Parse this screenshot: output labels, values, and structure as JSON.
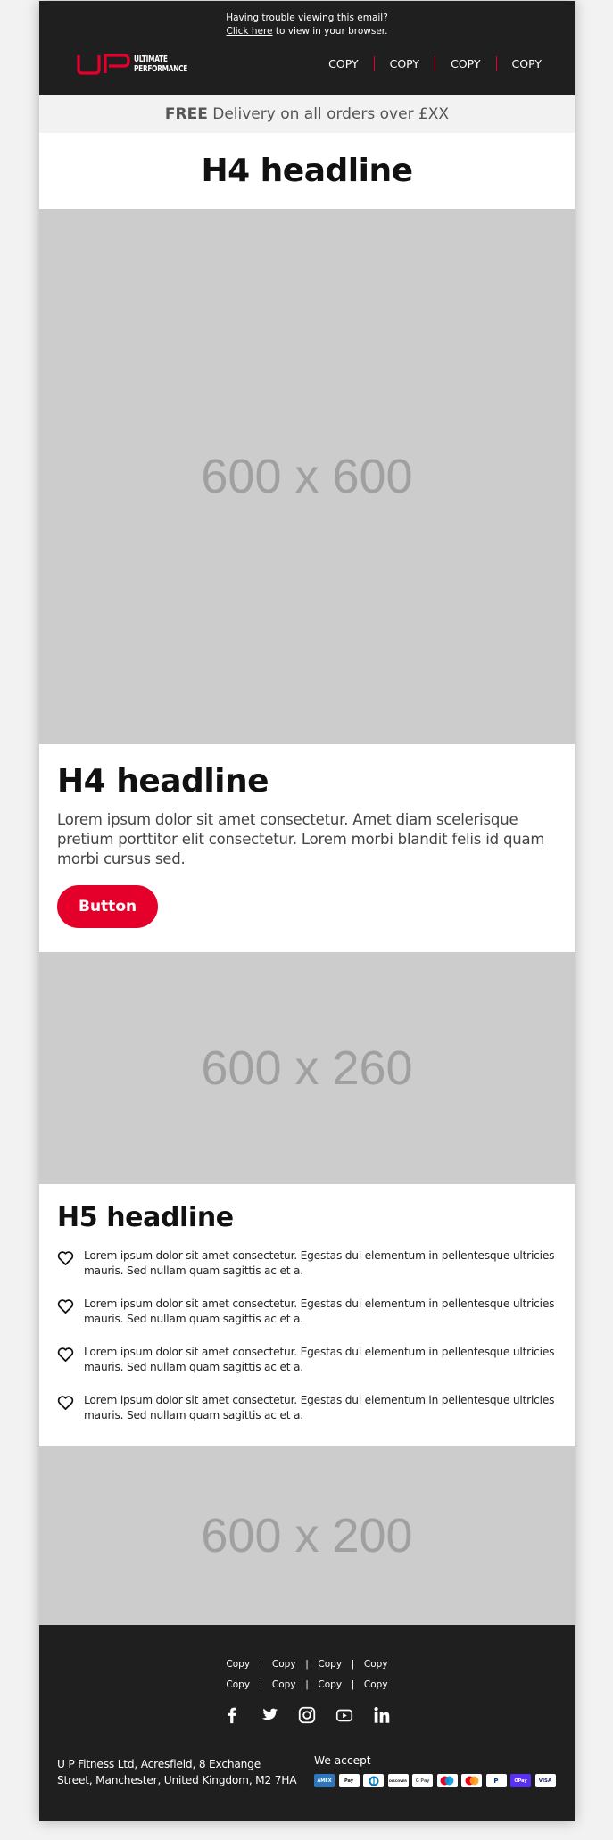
{
  "preheader": {
    "line1": "Having trouble viewing this email?",
    "link_text": "Click here",
    "line2_rest": " to view in your browser."
  },
  "logo": {
    "line1": "ULTIMATE",
    "line2": "PERFORMANCE",
    "accent": "#e4002b"
  },
  "nav": {
    "items": [
      {
        "label": "COPY"
      },
      {
        "label": "COPY"
      },
      {
        "label": "COPY"
      },
      {
        "label": "COPY"
      }
    ]
  },
  "promo": {
    "bold": "FREE",
    "rest": " Delivery on all orders over £XX"
  },
  "hero": {
    "headline": "H4 headline",
    "image_label": "600 x 600"
  },
  "feature": {
    "headline": "H4 headline",
    "body": "Lorem ipsum dolor sit amet consectetur. Amet diam scelerisque pretium porttitor elit consectetur. Lorem morbi blandit felis id quam morbi cursus sed.",
    "button_label": "Button",
    "button_color": "#e4002b"
  },
  "image2": {
    "label": "600 x 260"
  },
  "list_section": {
    "headline": "H5 headline",
    "items": [
      {
        "icon": "heart-icon",
        "text": "Lorem ipsum dolor sit amet consectetur. Egestas dui elementum in pellentesque ultricies mauris. Sed nullam quam sagittis ac et a."
      },
      {
        "icon": "heart-icon",
        "text": "Lorem ipsum dolor sit amet consectetur. Egestas dui elementum in pellentesque ultricies mauris. Sed nullam quam sagittis ac et a."
      },
      {
        "icon": "heart-icon",
        "text": "Lorem ipsum dolor sit amet consectetur. Egestas dui elementum in pellentesque ultricies mauris. Sed nullam quam sagittis ac et a."
      },
      {
        "icon": "heart-icon",
        "text": "Lorem ipsum dolor sit amet consectetur. Egestas dui elementum in pellentesque ultricies mauris. Sed nullam quam sagittis ac et a."
      }
    ]
  },
  "image3": {
    "label": "600 x 200"
  },
  "footer": {
    "link_rows": [
      [
        "Copy",
        "Copy",
        "Copy",
        "Copy"
      ],
      [
        "Copy",
        "Copy",
        "Copy",
        "Copy"
      ]
    ],
    "separator": "|",
    "social": [
      "facebook-icon",
      "twitter-icon",
      "instagram-icon",
      "youtube-icon",
      "linkedin-icon"
    ],
    "address_line1": "U P Fitness Ltd, Acresfield, 8 Exchange",
    "address_line2": "Street, Manchester, United Kingdom, M2 7HA",
    "accept_label": "We accept",
    "payment_methods": [
      {
        "name": "amex",
        "label": "AMEX"
      },
      {
        "name": "apple-pay",
        "label": "Pay"
      },
      {
        "name": "diners",
        "label": ""
      },
      {
        "name": "discover",
        "label": "DISCOVER"
      },
      {
        "name": "google-pay",
        "label": "G Pay"
      },
      {
        "name": "maestro",
        "label": ""
      },
      {
        "name": "mastercard",
        "label": ""
      },
      {
        "name": "paypal",
        "label": "P"
      },
      {
        "name": "shop-pay",
        "label": "OPay"
      },
      {
        "name": "visa",
        "label": "VISA"
      }
    ]
  },
  "colors": {
    "header_bg": "#1f1f1f",
    "accent": "#e4002b",
    "placeholder_bg": "#cccccc",
    "placeholder_text": "#a0a0a0",
    "promo_bg": "#f2f2f2"
  }
}
